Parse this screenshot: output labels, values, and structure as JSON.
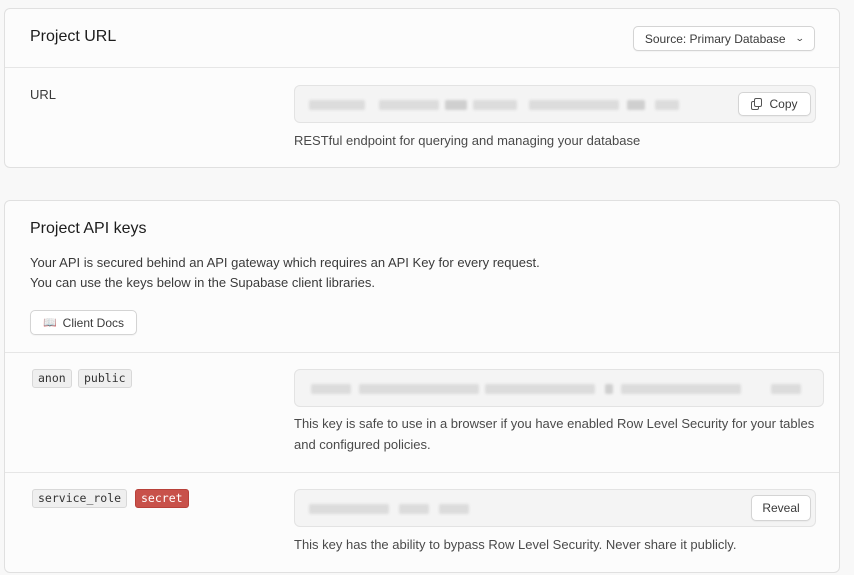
{
  "project_url": {
    "title": "Project URL",
    "source_button": "Source: Primary Database",
    "url_label": "URL",
    "copy_label": "Copy",
    "help": "RESTful endpoint for querying and managing your database"
  },
  "api_keys": {
    "title": "Project API keys",
    "description_line1": "Your API is secured behind an API gateway which requires an API Key for every request.",
    "description_line2": "You can use the keys below in the Supabase client libraries.",
    "docs_button": "Client Docs",
    "anon": {
      "tags": [
        "anon",
        "public"
      ],
      "help": "This key is safe to use in a browser if you have enabled Row Level Security for your tables and configured policies."
    },
    "service_role": {
      "tags": [
        "service_role",
        "secret"
      ],
      "reveal_label": "Reveal",
      "help": "This key has the ability to bypass Row Level Security. Never share it publicly."
    }
  },
  "icons": [
    "chevron-down-icon",
    "copy-icon",
    "book-icon"
  ],
  "colors": {
    "secret_tag": "#c8514a",
    "card_background": "#fcfcfc",
    "page_background": "#f8f8f8"
  }
}
